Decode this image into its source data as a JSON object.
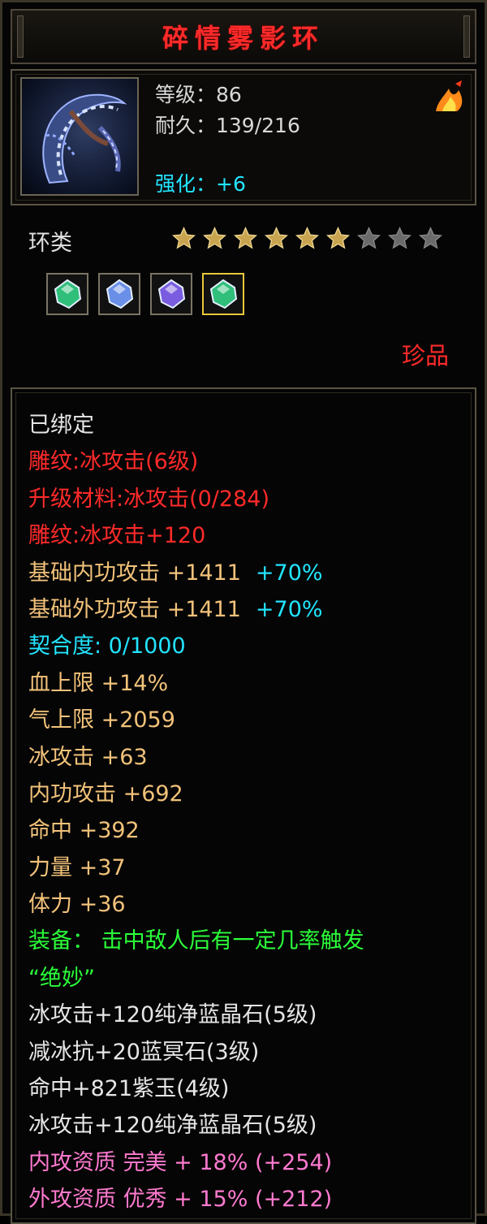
{
  "item": {
    "name": "碎情雾影环",
    "level_text": "等级：86",
    "durability_text": "耐久：139/216",
    "enhance_text": "强化：+6",
    "type": "环类",
    "stars": {
      "filled": 6,
      "total": 9
    },
    "rarity": "珍品"
  },
  "gems": [
    {
      "icon": "green-crystal-gem-icon",
      "color": "#2fbf7a",
      "selected": false
    },
    {
      "icon": "blue-crystal-gem-icon",
      "color": "#6a8fe8",
      "selected": false
    },
    {
      "icon": "purple-jade-gem-icon",
      "color": "#7a5ce0",
      "selected": false
    },
    {
      "icon": "green-crystal-gem-icon",
      "color": "#2fbf7a",
      "selected": true
    }
  ],
  "details": {
    "bound": "已绑定",
    "engrave": "雕纹:冰攻击(6级)",
    "upgrade_material": "升级材料:冰攻击(0/284)",
    "engrave_bonus": "雕纹:冰攻击+120",
    "base_inner_attack": {
      "label": "基础内功攻击  +1411",
      "pct": "+70%"
    },
    "base_outer_attack": {
      "label": "基础外功攻击  +1411",
      "pct": "+70%"
    },
    "fit": "契合度: 0/1000",
    "attributes": [
      "血上限  +14%",
      "气上限  +2059",
      "冰攻击  +63",
      "内功攻击  +692",
      "命中  +392",
      "力量  +37",
      "体力  +36"
    ],
    "equip_effect_1": "装备：  击中敌人后有一定几率触发",
    "equip_effect_2": "“绝妙”",
    "gem_lines": [
      "冰攻击+120纯净蓝晶石(5级)",
      "减冰抗+20蓝冥石(3级)",
      "命中+821紫玉(4级)",
      "冰攻击+120纯净蓝晶石(5级)"
    ],
    "quality_lines": [
      "内攻资质  完美  +  18% (+254)",
      "外攻资质  优秀  +  15% (+212)"
    ]
  },
  "colors": {
    "title": "#ff2a2a",
    "red": "#ff2a2a",
    "cyan": "#22e4ff",
    "gold": "#f2c27a",
    "green": "#2bff3a",
    "pink": "#ff7ad0",
    "star_filled": "#c8a450",
    "star_empty": "#6a6a6a"
  }
}
